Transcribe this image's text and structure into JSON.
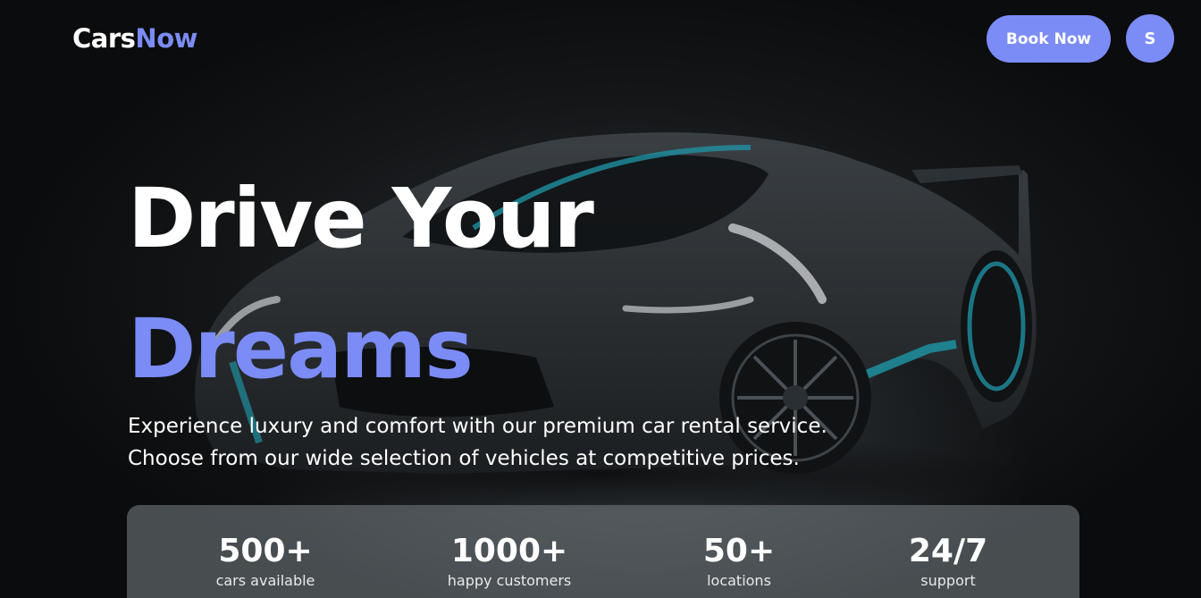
{
  "header": {
    "logo_primary": "Cars",
    "logo_accent": "Now",
    "book_label": "Book Now",
    "avatar_initial": "S"
  },
  "hero": {
    "title_line1": "Drive Your",
    "title_line2": "Dreams",
    "subtitle_line1": "Experience luxury and comfort with our premium car rental service.",
    "subtitle_line2": "Choose from our wide selection of vehicles at competitive prices."
  },
  "stats": [
    {
      "value": "500+",
      "label": "cars available"
    },
    {
      "value": "1000+",
      "label": "happy customers"
    },
    {
      "value": "50+",
      "label": "locations"
    },
    {
      "value": "24/7",
      "label": "support"
    }
  ],
  "colors": {
    "accent": "#7b8cf6",
    "car_trim": "#1f8fa0"
  }
}
